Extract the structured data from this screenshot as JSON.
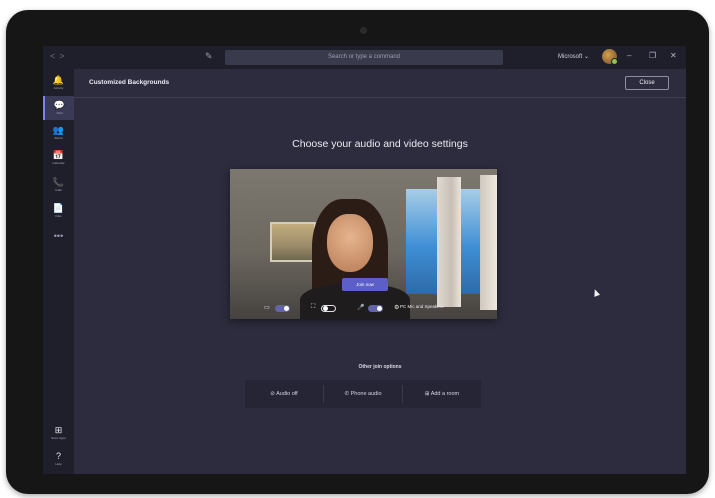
{
  "titlebar": {
    "nav_back": "<",
    "nav_forward": ">",
    "compose_glyph": "✎",
    "search_placeholder": "Search or type a command",
    "tenant": "Microsoft ⌄",
    "minimize": "–",
    "maximize": "❐",
    "close": "✕"
  },
  "rail": {
    "items": [
      {
        "glyph": "🔔",
        "label": "Activity",
        "icon": "bell-icon"
      },
      {
        "glyph": "💬",
        "label": "Chat",
        "icon": "chat-icon"
      },
      {
        "glyph": "👥",
        "label": "Teams",
        "icon": "teams-icon"
      },
      {
        "glyph": "📅",
        "label": "Calendar",
        "icon": "calendar-icon"
      },
      {
        "glyph": "📞",
        "label": "Calls",
        "icon": "phone-icon"
      },
      {
        "glyph": "📄",
        "label": "Files",
        "icon": "file-icon"
      }
    ],
    "more": "•••",
    "bottom": [
      {
        "glyph": "⊞",
        "label": "Store Apps",
        "icon": "apps-icon"
      },
      {
        "glyph": "?",
        "label": "Help",
        "icon": "help-icon"
      }
    ]
  },
  "header": {
    "title": "Customized Backgrounds",
    "close_label": "Close"
  },
  "prompt": "Choose your audio and video settings",
  "video": {
    "join_label": "Join now",
    "camera_glyph": "▭",
    "blur_glyph": "⛶",
    "mic_glyph": "🎤",
    "settings_glyph": "⚙",
    "device_settings": "PC Mic and Speakers"
  },
  "other_options": {
    "label": "Other join options",
    "audio_off": "⊘ Audio off",
    "phone_audio": "✆ Phone audio",
    "add_room": "⊞ Add a room"
  }
}
